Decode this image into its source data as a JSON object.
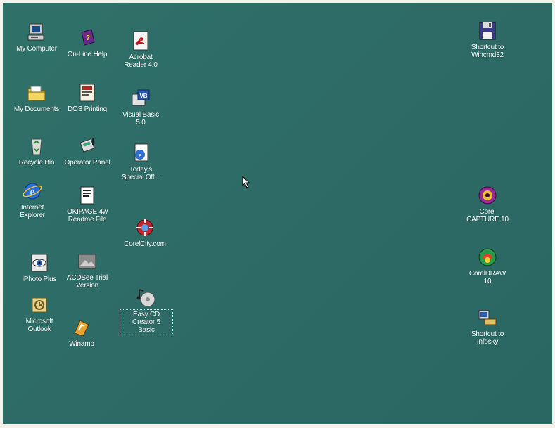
{
  "desktop": {
    "background_color": "#2e6b67",
    "icons": [
      {
        "label": "My Computer",
        "icon": "computer-icon"
      },
      {
        "label": "On-Line Help",
        "icon": "help-book-icon"
      },
      {
        "label": "Acrobat\nReader 4.0",
        "icon": "acrobat-icon"
      },
      {
        "label": "My Documents",
        "icon": "folder-icon"
      },
      {
        "label": "DOS Printing",
        "icon": "printer-doc-icon"
      },
      {
        "label": "Visual Basic\n5.0",
        "icon": "visual-basic-icon"
      },
      {
        "label": "Recycle Bin",
        "icon": "recycle-bin-icon"
      },
      {
        "label": "Operator Panel",
        "icon": "operator-panel-icon"
      },
      {
        "label": "Today's\nSpecial Off...",
        "icon": "ie-page-icon"
      },
      {
        "label": "Internet\nExplorer",
        "icon": "internet-explorer-icon"
      },
      {
        "label": "OKIPAGE 4w\nReadme File",
        "icon": "readme-icon"
      },
      {
        "label": "CorelCity.com",
        "icon": "corelcity-icon"
      },
      {
        "label": "iPhoto Plus",
        "icon": "iphoto-icon"
      },
      {
        "label": "ACDSee Trial\nVersion",
        "icon": "acdsee-icon"
      },
      {
        "label": "Microsoft\nOutlook",
        "icon": "outlook-icon"
      },
      {
        "label": "Easy CD\nCreator 5\nBasic",
        "icon": "easy-cd-icon"
      },
      {
        "label": "Winamp",
        "icon": "winamp-icon"
      },
      {
        "label": "Shortcut to\nWincmd32",
        "icon": "floppy-icon"
      },
      {
        "label": "Corel\nCAPTURE 10",
        "icon": "corel-capture-icon"
      },
      {
        "label": "CorelDRAW\n10",
        "icon": "coreldraw-icon"
      },
      {
        "label": "Shortcut to\nInfosky",
        "icon": "infosky-icon"
      }
    ]
  }
}
